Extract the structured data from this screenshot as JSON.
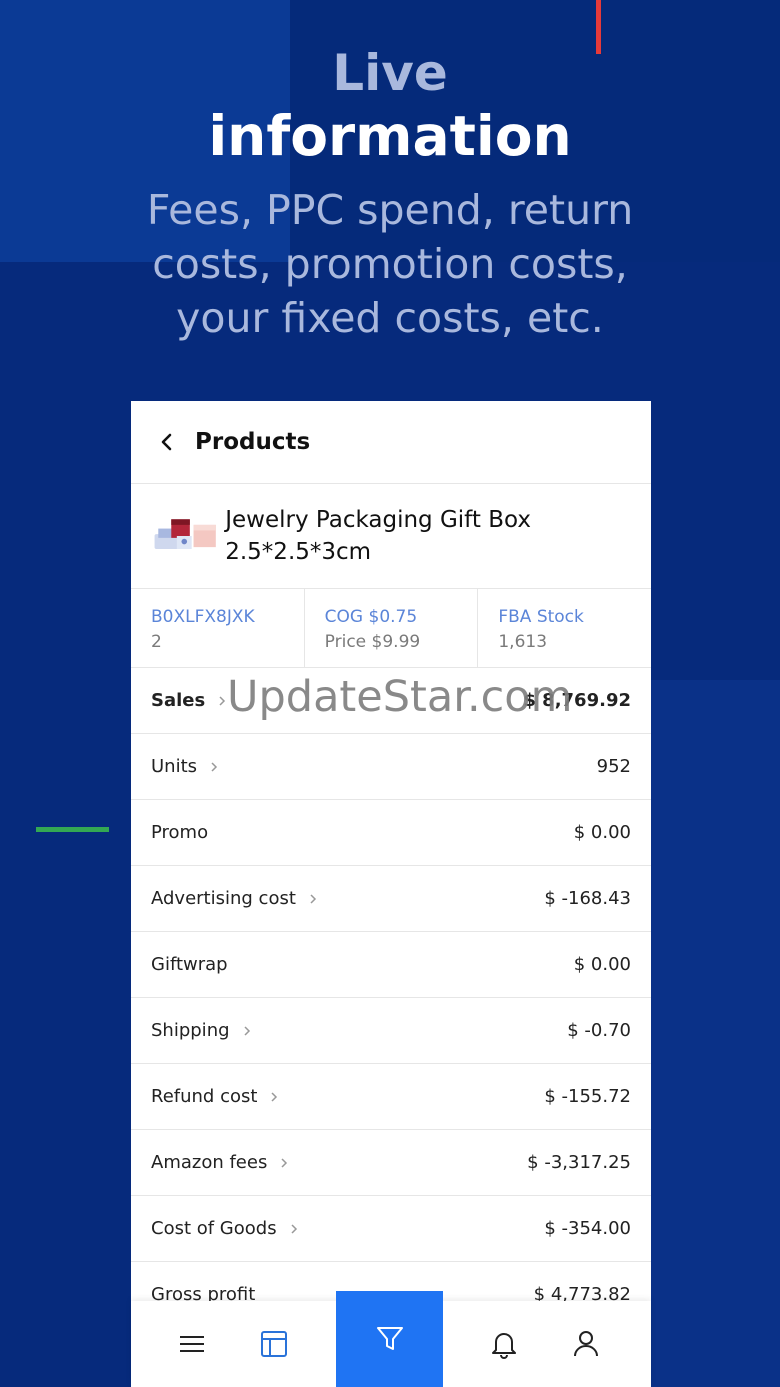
{
  "promo": {
    "title_line1": "Live",
    "title_line2": "information",
    "subtitle": "Fees, PPC spend, return costs, promotion costs, your fixed costs, etc."
  },
  "header": {
    "title": "Products"
  },
  "product": {
    "name": "Jewelry Packaging Gift Box 2.5*2.5*3cm"
  },
  "stats": [
    {
      "top": "B0XLFX8JXK",
      "bottom": "2"
    },
    {
      "top": "COG $0.75",
      "bottom": "Price $9.99"
    },
    {
      "top": "FBA Stock",
      "bottom": "1,613"
    }
  ],
  "rows": [
    {
      "label": "Sales",
      "value": "$ 8,769.92"
    },
    {
      "label": "Units",
      "value": "952"
    },
    {
      "label": "Promo",
      "value": "$ 0.00"
    },
    {
      "label": "Advertising cost",
      "value": "$ -168.43"
    },
    {
      "label": "Giftwrap",
      "value": "$ 0.00"
    },
    {
      "label": "Shipping",
      "value": "$ -0.70"
    },
    {
      "label": "Refund cost",
      "value": "$ -155.72"
    },
    {
      "label": "Amazon fees",
      "value": "$ -3,317.25"
    },
    {
      "label": "Cost of Goods",
      "value": "$ -354.00"
    },
    {
      "label": "Gross profit",
      "value": "$ 4,773.82"
    }
  ],
  "watermark": "UpdateStar.com",
  "nav": [
    "menu-icon",
    "dashboard-icon",
    "filter-icon",
    "bell-icon",
    "user-icon"
  ],
  "colors": {
    "background": "#062a7c",
    "accent": "#1f74f3",
    "link": "#5b85d8"
  }
}
